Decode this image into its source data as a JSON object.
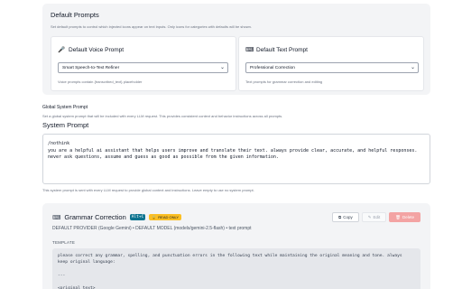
{
  "default_prompts": {
    "title": "Default Prompts",
    "description": "Set default prompts to control which injected icons appear on text inputs. Only icons for categories with defaults will be shown.",
    "voice": {
      "title": "Default Voice Prompt",
      "icon": "microphone-icon",
      "selected": "Smart Speech-to-Text Refiner",
      "note": "Voice prompts contain {transcribed_text} placeholder"
    },
    "text": {
      "title": "Default Text Prompt",
      "icon": "keyboard-icon",
      "selected": "Professional Correction",
      "note": "Text prompts for grammar correction and editing"
    }
  },
  "global_system_prompt": {
    "heading": "Global System Prompt",
    "description": "Set a global system prompt that will be included with every LLM request. This provides consistent context and behavior instructions across all prompts.",
    "label": "System Prompt",
    "value": "/nothink\nyou are a helpful ai assistant that helps users improve and translate their text. always provide clear, accurate, and helpful responses. never ask questions, assume and guess as good as possible from the given information.",
    "note": "This system prompt is sent with every LLM request to provide global context and instructions. Leave empty to use no system prompt."
  },
  "grammar_correction": {
    "title": "Grammar Correction",
    "shortcut": "Alt+C",
    "badge": "READ ONLY",
    "meta": "DEFAULT PROVIDER (Google Gemini) • DEFAULT MODEL (models/gemini-2.5-flash) • text prompt",
    "actions": {
      "copy": "Copy",
      "edit": "Edit",
      "delete": "Delete"
    },
    "template_label": "TEMPLATE",
    "template": "please correct any grammar, spelling, and punctuation errors in the following text while maintaining the original meaning and tone. always\nkeep original language:\n\n---\n\n<original_text>\n{text}"
  },
  "colors": {
    "accent": "#0e7490",
    "badge": "#fbbf24",
    "delete": "#f3a3a3",
    "panel": "#f3f4f6"
  }
}
